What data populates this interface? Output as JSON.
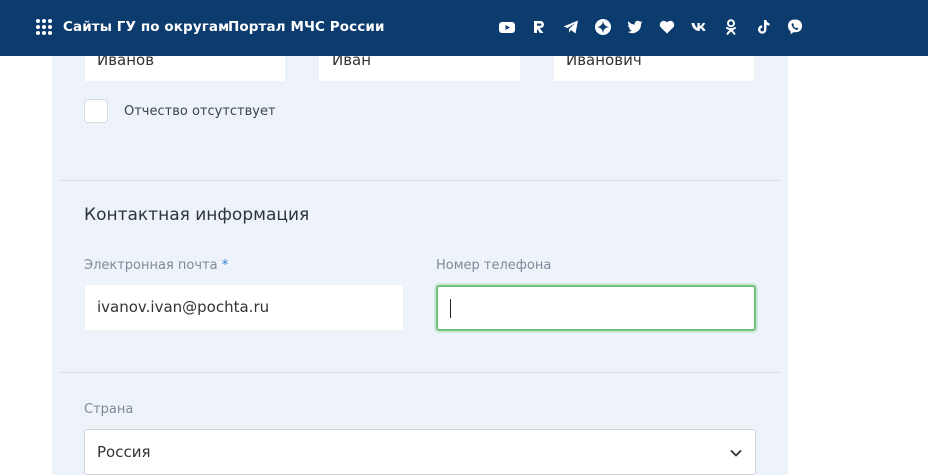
{
  "header": {
    "regions_link": "Сайты ГУ по округам",
    "portal_link": "Портал МЧС России",
    "social_icons": [
      "youtube-icon",
      "rutube-icon",
      "telegram-icon",
      "dzen-icon",
      "twitter-icon",
      "heart-icon",
      "vk-icon",
      "odnoklassniki-icon",
      "tiktok-icon",
      "viber-icon"
    ]
  },
  "name_fields": {
    "last_name": "Иванов",
    "first_name": "Иван",
    "middle_name": "Иванович"
  },
  "no_middle_name_label": "Отчество отсутствует",
  "contact": {
    "title": "Контактная информация",
    "email_label": "Электронная почта",
    "required_mark": "*",
    "email_value": "ivanov.ivan@pochta.ru",
    "phone_label": "Номер телефона",
    "phone_value": ""
  },
  "country": {
    "label": "Страна",
    "selected": "Россия"
  },
  "colors": {
    "header_bg": "#0c3b6e",
    "panel_bg": "#eef3f9",
    "focus_green": "#6fc47c",
    "required_blue": "#2f7fd1"
  }
}
